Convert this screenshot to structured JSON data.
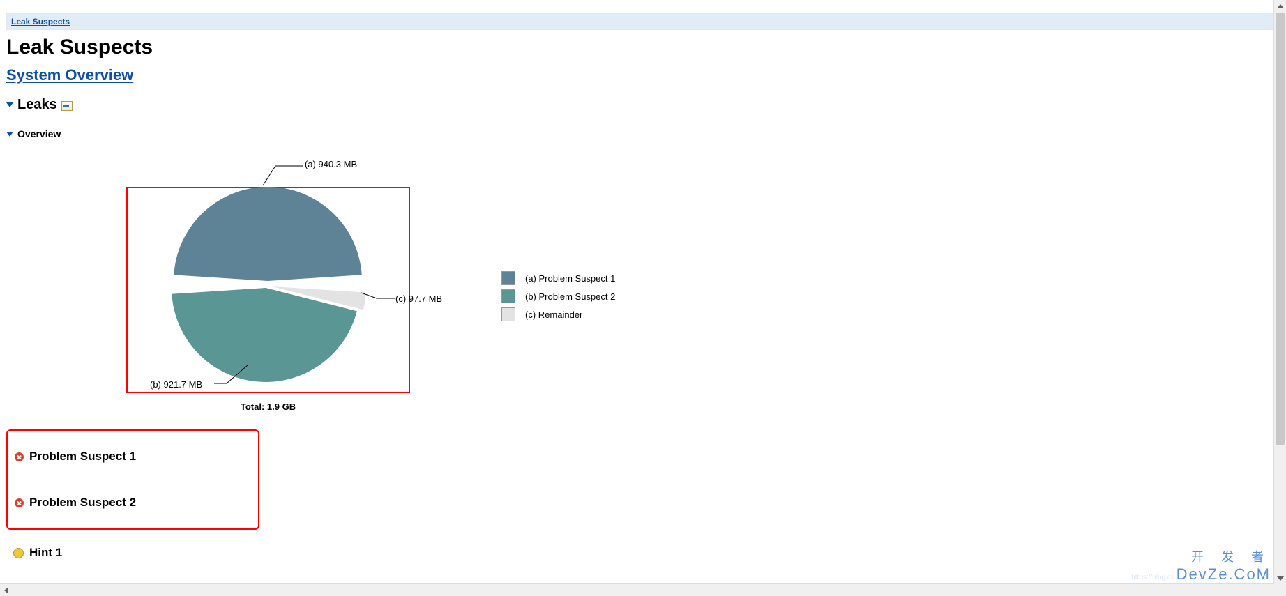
{
  "breadcrumb": {
    "label": "Leak Suspects"
  },
  "page_title": "Leak Suspects",
  "system_overview_link": "System Overview",
  "sections": {
    "leaks_heading": "Leaks",
    "overview_heading": "Overview"
  },
  "chart_data": {
    "type": "pie",
    "title": "",
    "total_label": "Total: 1.9 GB",
    "series": [
      {
        "key": "a",
        "name": "Problem Suspect 1",
        "value_mb": 940.3,
        "callout": "(a)  940.3 MB",
        "legend": "(a)  Problem Suspect 1",
        "color": "#5e8296"
      },
      {
        "key": "b",
        "name": "Problem Suspect 2",
        "value_mb": 921.7,
        "callout": "(b)  921.7 MB",
        "legend": "(b)  Problem Suspect 2",
        "color": "#5a9693"
      },
      {
        "key": "c",
        "name": "Remainder",
        "value_mb": 97.7,
        "callout": "(c)  97.7 MB",
        "legend": "(c)  Remainder",
        "color": "#e3e3e3"
      }
    ]
  },
  "suspects": [
    {
      "label": "Problem Suspect 1"
    },
    {
      "label": "Problem Suspect 2"
    }
  ],
  "hint": {
    "label": "Hint 1"
  },
  "watermark": {
    "cn": "开 发 者",
    "lat": "DevZe.CoM",
    "faint": "https://blog.cs"
  }
}
